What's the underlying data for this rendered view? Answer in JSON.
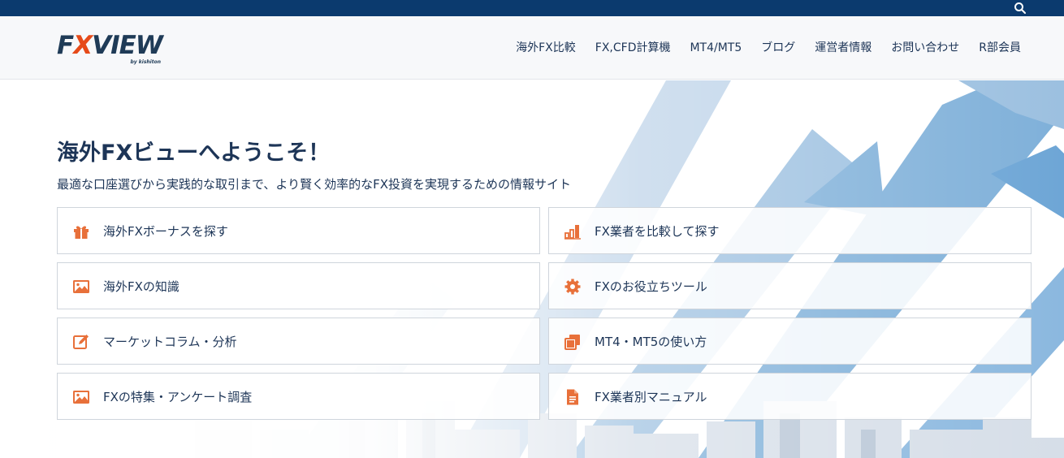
{
  "header": {
    "logo": {
      "word": "FXVIEW",
      "tagline": "by kishiton"
    },
    "nav": [
      {
        "label": "海外FX比較"
      },
      {
        "label": "FX,CFD計算機"
      },
      {
        "label": "MT4/MT5"
      },
      {
        "label": "ブログ"
      },
      {
        "label": "運営者情報"
      },
      {
        "label": "お問い合わせ"
      },
      {
        "label": "R部会員"
      }
    ]
  },
  "hero": {
    "title": "海外FXビューへようこそ！",
    "subtitle": "最適な口座選びから実践的な取引まで、より賢く効率的なFX投資を実現するための情報サイト"
  },
  "cards": [
    {
      "label": "海外FXボーナスを探す",
      "icon": "gift-icon"
    },
    {
      "label": "FX業者を比較して探す",
      "icon": "bar-chart-icon"
    },
    {
      "label": "海外FXの知識",
      "icon": "image-icon"
    },
    {
      "label": "FXのお役立ちツール",
      "icon": "gear-icon"
    },
    {
      "label": "マーケットコラム・分析",
      "icon": "edit-icon"
    },
    {
      "label": "MT4・MT5の使い方",
      "icon": "copy-icon"
    },
    {
      "label": "FXの特集・アンケート調査",
      "icon": "image-icon"
    },
    {
      "label": "FX業者別マニュアル",
      "icon": "document-icon"
    }
  ],
  "colors": {
    "topbar": "#0b3a6e",
    "text": "#1d3557",
    "accent_icon": "#e8703a",
    "logo_x": "#e64a19"
  }
}
